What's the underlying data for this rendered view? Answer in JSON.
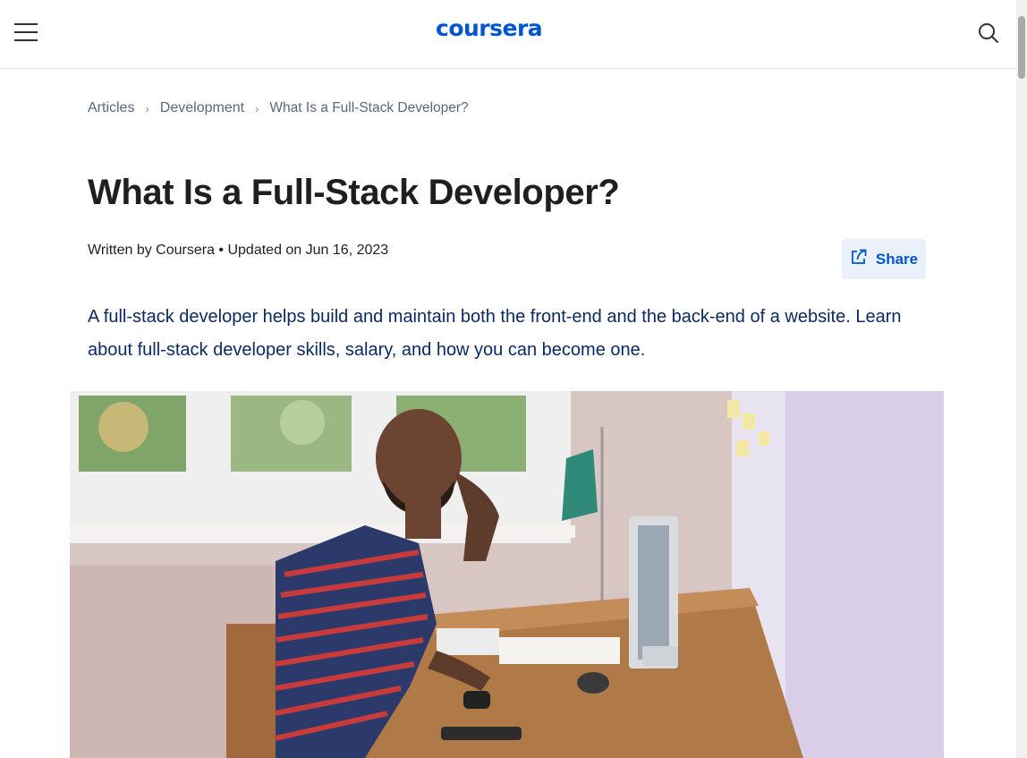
{
  "header": {
    "menu_icon": "hamburger-menu-icon",
    "logo_text": "coursera",
    "search_icon": "search-icon",
    "brand_color": "#0056d2"
  },
  "breadcrumb": {
    "items": [
      "Articles",
      "Development",
      "What Is a Full-Stack Developer?"
    ],
    "separator_icon": "chevron-right-icon"
  },
  "article": {
    "title": "What Is a Full-Stack Developer?",
    "byline": "Written by Coursera • Updated on Jun 16, 2023",
    "share_label": "Share",
    "share_icon": "share-external-icon",
    "summary": "A full-stack developer helps build and maintain both the front-end and the back-end of a website. Learn about full-stack developer skills, salary, and how you can become one.",
    "hero_image": "photo-man-at-desk-computer"
  }
}
